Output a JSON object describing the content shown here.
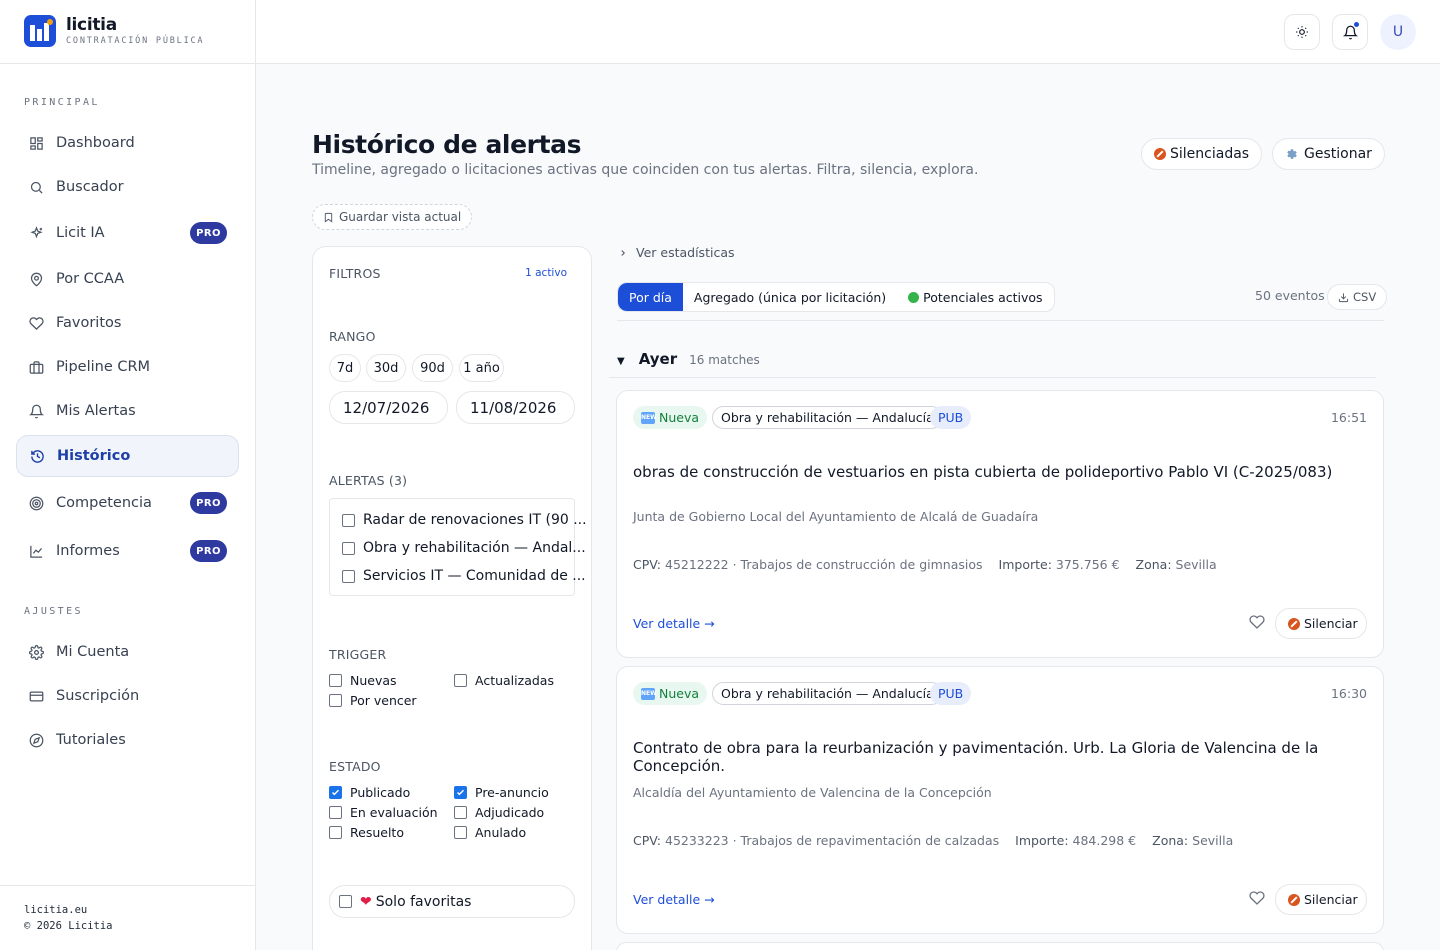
{
  "brand": {
    "name": "licitia",
    "subtitle": "CONTRATACIÓN PÚBLICA"
  },
  "topbar": {
    "avatar_initial": "U",
    "icons": [
      "sun-icon",
      "bell-icon"
    ]
  },
  "sidebar": {
    "section_main": "PRINCIPAL",
    "section_settings": "AJUSTES",
    "items": [
      {
        "label": "Dashboard",
        "icon": "grid-icon"
      },
      {
        "label": "Buscador",
        "icon": "search-icon"
      },
      {
        "label": "Licit IA",
        "icon": "sparkle-icon",
        "badge": "PRO"
      },
      {
        "label": "Por CCAA",
        "icon": "map-pin-icon"
      },
      {
        "label": "Favoritos",
        "icon": "heart-icon"
      },
      {
        "label": "Pipeline CRM",
        "icon": "briefcase-icon"
      },
      {
        "label": "Mis Alertas",
        "icon": "bell-icon"
      },
      {
        "label": "Histórico",
        "icon": "history-icon",
        "active": true
      },
      {
        "label": "Competencia",
        "icon": "target-icon",
        "badge": "PRO"
      },
      {
        "label": "Informes",
        "icon": "chart-icon",
        "badge": "PRO"
      }
    ],
    "settings_items": [
      {
        "label": "Mi Cuenta",
        "icon": "gear-icon"
      },
      {
        "label": "Suscripción",
        "icon": "card-icon"
      },
      {
        "label": "Tutoriales",
        "icon": "compass-icon"
      }
    ],
    "footer": {
      "site": "licitia.eu",
      "copyright": "© 2026 Licitia"
    }
  },
  "header": {
    "title": "Histórico de alertas",
    "subtitle": "Timeline, agregado o licitaciones activas que coinciden con tus alertas. Filtra, silencia, explora.",
    "silenced_button": "Silenciadas",
    "manage_button": "Gestionar",
    "save_view": "Guardar vista actual"
  },
  "filters": {
    "title": "FILTROS",
    "active_count": "1 activo",
    "range_label": "RANGO",
    "range_chips": [
      "7d",
      "30d",
      "90d",
      "1 año"
    ],
    "date_from": "12/07/2026",
    "date_to": "11/08/2026",
    "alerts_label": "ALERTAS (3)",
    "alerts": [
      "Radar de renovaciones IT (90 ...",
      "Obra y rehabilitación — Andal...",
      "Servicios IT — Comunidad de ..."
    ],
    "trigger_label": "TRIGGER",
    "triggers": [
      {
        "label": "Nuevas",
        "checked": false
      },
      {
        "label": "Actualizadas",
        "checked": false
      },
      {
        "label": "Por vencer",
        "checked": false
      }
    ],
    "state_label": "ESTADO",
    "states": [
      {
        "label": "Publicado",
        "checked": true
      },
      {
        "label": "Pre-anuncio",
        "checked": true
      },
      {
        "label": "En evaluación",
        "checked": false
      },
      {
        "label": "Adjudicado",
        "checked": false
      },
      {
        "label": "Resuelto",
        "checked": false
      },
      {
        "label": "Anulado",
        "checked": false
      }
    ],
    "only_favorites": "Solo favoritas"
  },
  "timeline": {
    "stats_link": "Ver estadísticas",
    "tabs": [
      "Por día",
      "Agregado (única por licitación)",
      "Potenciales activos"
    ],
    "events_count": "50 eventos",
    "csv_button": "CSV",
    "day": "Ayer",
    "day_matches": "16 matches",
    "cards": [
      {
        "badge_new": "Nueva",
        "alert_tag": "Obra y rehabilitación — Andalucía",
        "status_tag": "PUB",
        "time": "16:51",
        "title": "obras de construcción de vestuarios en pista cubierta de polideportivo Pablo VI (C-2025/083)",
        "org": "Junta de Gobierno Local del Ayuntamiento de Alcalá de Guadaíra",
        "cpv_label": "CPV:",
        "cpv": "45212222 · Trabajos de construcción de gimnasios",
        "amount_label": "Importe:",
        "amount": "375.756 €",
        "zone_label": "Zona:",
        "zone": "Sevilla",
        "detail_link": "Ver detalle →",
        "silence_button": "Silenciar"
      },
      {
        "badge_new": "Nueva",
        "alert_tag": "Obra y rehabilitación — Andalucía",
        "status_tag": "PUB",
        "time": "16:30",
        "title": "Contrato de obra para la reurbanización y pavimentación. Urb. La Gloria de Valencina de la Concepción.",
        "org": "Alcaldía del Ayuntamiento de Valencina de la Concepción",
        "cpv_label": "CPV:",
        "cpv": "45233223 · Trabajos de repavimentación de calzadas",
        "amount_label": "Importe:",
        "amount": "484.298 €",
        "zone_label": "Zona:",
        "zone": "Sevilla",
        "detail_link": "Ver detalle →",
        "silence_button": "Silenciar"
      }
    ]
  }
}
